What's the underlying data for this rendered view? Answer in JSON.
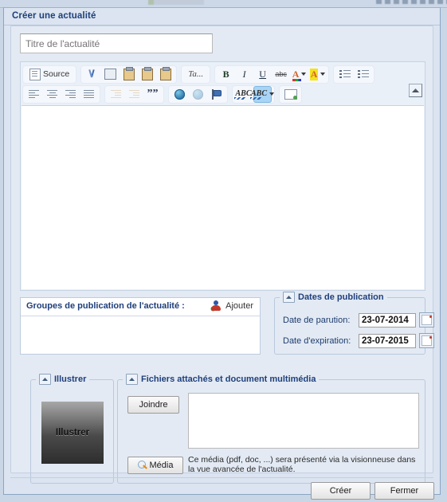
{
  "dialog": {
    "title": "Créer une actualité",
    "title_input": {
      "placeholder": "Titre de l'actualité",
      "value": ""
    }
  },
  "editor": {
    "toolbar_row1": [
      {
        "name": "source-button",
        "label": "Source",
        "icon": "source-icon",
        "state": "normal"
      },
      {
        "name": "cut-button",
        "label": "",
        "icon": "scissors-icon",
        "state": "normal"
      },
      {
        "name": "copy-button",
        "label": "",
        "icon": "copy-icon",
        "state": "normal"
      },
      {
        "name": "paste-button",
        "label": "",
        "icon": "paste-icon",
        "state": "normal"
      },
      {
        "name": "paste-text-button",
        "label": "",
        "icon": "paste-text-icon",
        "state": "normal"
      },
      {
        "name": "paste-word-button",
        "label": "",
        "icon": "paste-word-icon",
        "state": "normal"
      },
      {
        "name": "format-select",
        "label": "Ta...",
        "icon": "format-dropdown-icon",
        "state": "normal"
      },
      {
        "name": "bold-button",
        "label": "B",
        "icon": "bold-icon",
        "state": "normal"
      },
      {
        "name": "italic-button",
        "label": "I",
        "icon": "italic-icon",
        "state": "normal"
      },
      {
        "name": "underline-button",
        "label": "U",
        "icon": "underline-icon",
        "state": "normal"
      },
      {
        "name": "strikethrough-button",
        "label": "abc",
        "icon": "strikethrough-icon",
        "state": "normal"
      },
      {
        "name": "text-color-button",
        "label": "A",
        "icon": "text-color-icon",
        "state": "normal"
      },
      {
        "name": "background-color-button",
        "label": "A",
        "icon": "highlight-color-icon",
        "state": "normal"
      },
      {
        "name": "numbered-list-button",
        "label": "",
        "icon": "ordered-list-icon",
        "state": "normal"
      },
      {
        "name": "bulleted-list-button",
        "label": "",
        "icon": "unordered-list-icon",
        "state": "normal"
      }
    ],
    "toolbar_row2": [
      {
        "name": "align-left-button",
        "label": "",
        "icon": "align-left-icon",
        "state": "normal"
      },
      {
        "name": "align-center-button",
        "label": "",
        "icon": "align-center-icon",
        "state": "normal"
      },
      {
        "name": "align-right-button",
        "label": "",
        "icon": "align-right-icon",
        "state": "normal"
      },
      {
        "name": "align-justify-button",
        "label": "",
        "icon": "align-justify-icon",
        "state": "normal"
      },
      {
        "name": "outdent-button",
        "label": "",
        "icon": "outdent-icon",
        "state": "disabled"
      },
      {
        "name": "indent-button",
        "label": "",
        "icon": "indent-icon",
        "state": "disabled"
      },
      {
        "name": "blockquote-button",
        "label": "",
        "icon": "blockquote-icon",
        "state": "normal"
      },
      {
        "name": "link-button",
        "label": "",
        "icon": "link-globe-icon",
        "state": "normal"
      },
      {
        "name": "unlink-button",
        "label": "",
        "icon": "unlink-globe-icon",
        "state": "disabled"
      },
      {
        "name": "anchor-button",
        "label": "",
        "icon": "anchor-flag-icon",
        "state": "normal"
      },
      {
        "name": "spellcheck-button",
        "label": "",
        "icon": "spellcheck-icon",
        "state": "normal"
      },
      {
        "name": "scayt-button",
        "label": "",
        "icon": "scayt-icon",
        "state": "active"
      },
      {
        "name": "page-break-button",
        "label": "",
        "icon": "page-break-icon",
        "state": "normal"
      }
    ],
    "content": "",
    "collapse_toolbar": "collapse-toolbar-icon"
  },
  "groups": {
    "title": "Groupes de publication de l'actualité :",
    "add_label": "Ajouter",
    "add_icon": "add-user-icon",
    "items": []
  },
  "dates": {
    "legend": "Dates de publication",
    "collapse_icon": "collapse-icon",
    "fields": [
      {
        "label": "Date de parution:",
        "value": "23-07-2014",
        "picker_icon": "calendar-icon"
      },
      {
        "label": "Date d'expiration:",
        "value": "23-07-2015",
        "picker_icon": "calendar-icon"
      }
    ]
  },
  "illustrer": {
    "legend": "Illustrer",
    "collapse_icon": "collapse-icon",
    "image_label": "Illustrer"
  },
  "files": {
    "legend": "Fichiers attachés et document multimédia",
    "collapse_icon": "collapse-icon",
    "joindre_label": "Joindre",
    "media_label": "Média",
    "media_icon": "magnifier-icon",
    "note": "Ce média (pdf, doc, ...) sera présenté via la visionneuse dans la vue avancée de l'actualité.",
    "list_items": []
  },
  "footer": {
    "create_label": "Créer",
    "close_label": "Fermer"
  }
}
